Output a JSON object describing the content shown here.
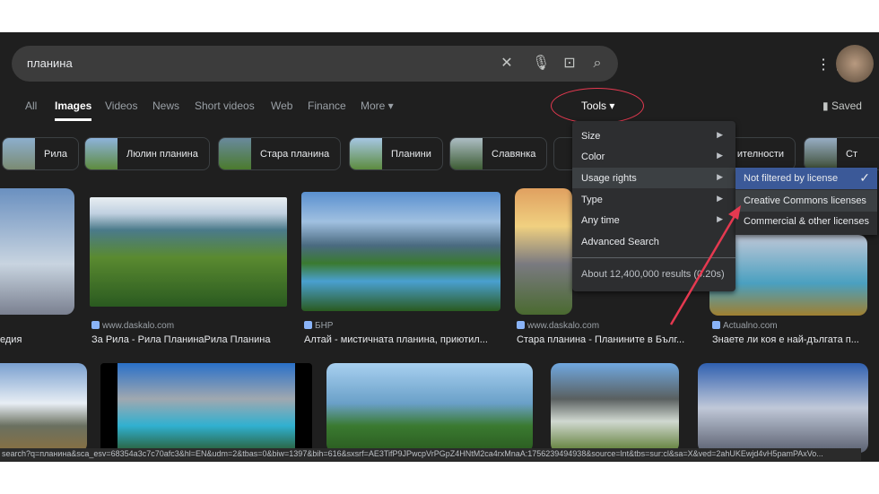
{
  "search": {
    "query": "планина"
  },
  "tabs": [
    {
      "label": "All"
    },
    {
      "label": "Images"
    },
    {
      "label": "Videos"
    },
    {
      "label": "News"
    },
    {
      "label": "Short videos"
    },
    {
      "label": "Web"
    },
    {
      "label": "Finance"
    },
    {
      "label": "More"
    }
  ],
  "tools_label": "Tools",
  "saved_label": "Saved",
  "chips": [
    {
      "label": "Рила"
    },
    {
      "label": "Люлин планина"
    },
    {
      "label": "Стара планина"
    },
    {
      "label": "Планини"
    },
    {
      "label": "Славянка"
    },
    {
      "label": "ителности"
    },
    {
      "label": "Ст"
    }
  ],
  "tools_menu": {
    "items": [
      {
        "label": "Size"
      },
      {
        "label": "Color"
      },
      {
        "label": "Usage rights"
      },
      {
        "label": "Type"
      },
      {
        "label": "Any time"
      },
      {
        "label": "Advanced Search"
      }
    ],
    "results": "About 12,400,000 results (0.20s)"
  },
  "usage_submenu": [
    {
      "label": "Not filtered by license",
      "checked": true
    },
    {
      "label": "Creative Commons licenses"
    },
    {
      "label": "Commercial & other licenses"
    }
  ],
  "results_row1": [
    {
      "source": "",
      "title": "едия"
    },
    {
      "source": "www.daskalo.com",
      "title": "За Рила - Рила ПланинаРила Планина"
    },
    {
      "source": "БНР",
      "title": "Алтай - мистичната планина, приютил..."
    },
    {
      "source": "www.daskalo.com",
      "title": "Стара планина - Планините в Бълг..."
    },
    {
      "source": "Actualno.com",
      "title": "Знаете ли коя е най-дългата п..."
    }
  ],
  "status_url": "search?q=планина&sca_esv=68354a3c7c70afc3&hl=EN&udm=2&tbas=0&biw=1397&bih=616&sxsrf=AE3TifP9JPwcpVrPGpZ4HNtM2ca4rxMnaA:1756239494938&source=lnt&tbs=sur:cl&sa=X&ved=2ahUKEwjd4vH5pamPAxVo...",
  "colors": {
    "background": "#1f1f1f",
    "highlight": "#3b5998",
    "annotation": "#e53950"
  }
}
